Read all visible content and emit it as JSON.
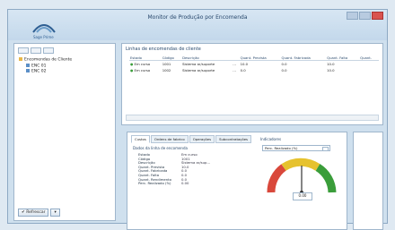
{
  "window": {
    "title": "Monitor de Produção por Encomenda",
    "logo_text": "Sage Prime"
  },
  "tree": {
    "items": [
      {
        "label": "Encomendas de Cliente"
      },
      {
        "label": "ENC 01"
      },
      {
        "label": "ENC 02"
      }
    ]
  },
  "orders": {
    "section_title": "Linhas de encomendas de cliente",
    "columns": [
      "Estado",
      "Código",
      "Descrição",
      "Quant. Prevista",
      "Quant. Fabricada",
      "Quant. Falta",
      "Quant."
    ],
    "rows": [
      {
        "estado": "Em curso",
        "codigo": "1001",
        "descricao": "Sistema ar/suporte",
        "extra": "...",
        "prevista": "10.0",
        "fabricada": "0.0",
        "falta": "10.0"
      },
      {
        "estado": "Em curso",
        "codigo": "1002",
        "descricao": "Sistema ar/suporte",
        "extra": "...",
        "prevista": "0.0",
        "fabricada": "0.0",
        "falta": "10.0"
      }
    ]
  },
  "tabs": [
    "Custos",
    "Ordens de fabrico",
    "Operações",
    "Subcontratações"
  ],
  "props": {
    "title": "Dados da linha de encomenda",
    "items": [
      {
        "key": "Estado",
        "value": "Em curso"
      },
      {
        "key": "Código",
        "value": "1001"
      },
      {
        "key": "Descrição",
        "value": "Sistema ar/sup..."
      },
      {
        "key": "Quant. Prevista",
        "value": "10.0"
      },
      {
        "key": "Quant. Fabricada",
        "value": "0.0"
      },
      {
        "key": "Quant. Falta",
        "value": "0.0"
      },
      {
        "key": "Quant. Rendimento",
        "value": "0.0"
      },
      {
        "key": "Perc. Realizado (%)",
        "value": "0.00"
      }
    ]
  },
  "indicator": {
    "title": "Indicadores",
    "select_value": "Perc. Realizado (%)",
    "gauge_value": "0.00",
    "gauge_fraction": 0.5
  },
  "footer": {
    "refresh_label": "Refrescar"
  },
  "colors": {
    "ok": "#3a9d3a",
    "warn": "#e6c22e",
    "bad": "#d9483b",
    "accent": "#2a4a6d"
  }
}
